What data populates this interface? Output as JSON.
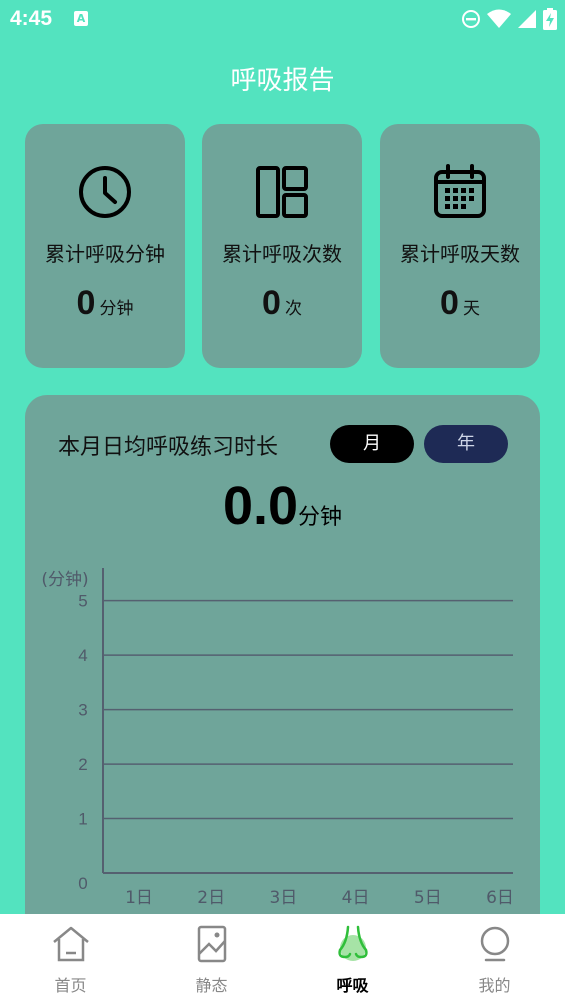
{
  "status_bar": {
    "time": "4:45",
    "notification_badge": "A"
  },
  "page": {
    "title": "呼吸报告"
  },
  "stats": [
    {
      "icon": "clock-icon",
      "label": "累计呼吸分钟",
      "value": "0",
      "unit": "分钟"
    },
    {
      "icon": "layout-icon",
      "label": "累计呼吸次数",
      "value": "0",
      "unit": "次"
    },
    {
      "icon": "calendar-icon",
      "label": "累计呼吸天数",
      "value": "0",
      "unit": "天"
    }
  ],
  "chart_card": {
    "title": "本月日均呼吸练习时长",
    "toggle_month": "月",
    "toggle_year": "年",
    "average_value": "0.0",
    "average_unit": "分钟"
  },
  "chart_data": {
    "type": "bar",
    "ylabel": "(分钟)",
    "categories": [
      "1日",
      "2日",
      "3日",
      "4日",
      "5日",
      "6日"
    ],
    "values": [
      0,
      0,
      0,
      0,
      0,
      0
    ],
    "yticks": [
      "0",
      "1",
      "2",
      "3",
      "4",
      "5"
    ],
    "ylim": [
      0,
      5.6
    ],
    "grid": true
  },
  "tab_bar": {
    "tabs": [
      {
        "label": "首页",
        "icon": "home-icon",
        "active": false
      },
      {
        "label": "静态",
        "icon": "picture-icon",
        "active": false
      },
      {
        "label": "呼吸",
        "icon": "nose-icon",
        "active": true
      },
      {
        "label": "我的",
        "icon": "profile-icon",
        "active": false
      }
    ]
  },
  "colors": {
    "background": "#53e3bf",
    "card": "#6fa59a",
    "active_tab": "#2fbf3a",
    "year_toggle": "#1e2a55"
  }
}
